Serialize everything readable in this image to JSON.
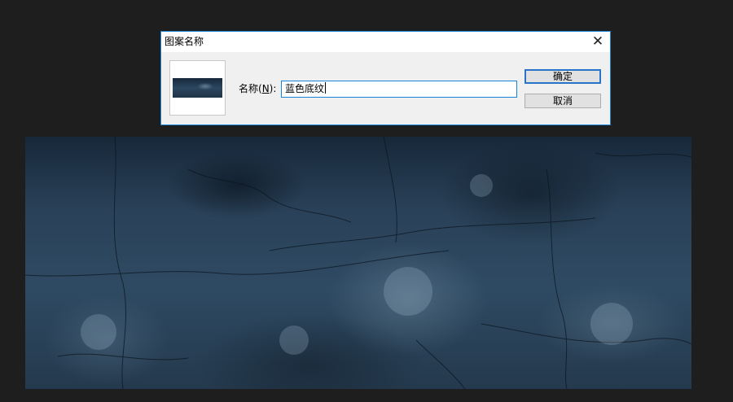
{
  "dialog": {
    "title": "图案名称",
    "close_glyph": "✕",
    "name_label_prefix": "名称(",
    "name_label_mnemonic": "N",
    "name_label_suffix": "):",
    "name_value": "蓝色底纹",
    "ok_label": "确定",
    "cancel_label": "取消"
  },
  "colors": {
    "workspace": "#1e1e1e",
    "dialog_bg": "#f0f0f0",
    "accent": "#1883d7",
    "texture_base": "#2e4a62"
  },
  "icons": {
    "close": "close-icon"
  }
}
